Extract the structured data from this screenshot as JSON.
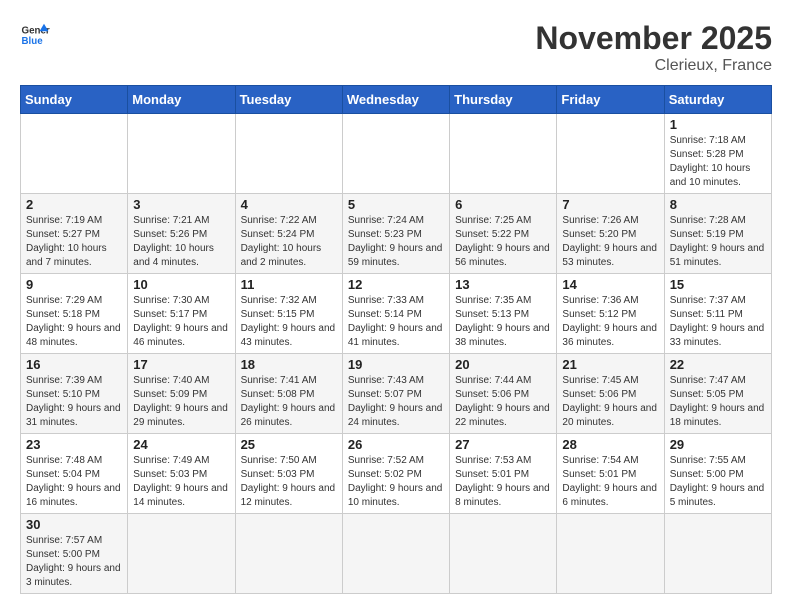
{
  "header": {
    "logo_general": "General",
    "logo_blue": "Blue",
    "month_title": "November 2025",
    "location": "Clerieux, France"
  },
  "days_of_week": [
    "Sunday",
    "Monday",
    "Tuesday",
    "Wednesday",
    "Thursday",
    "Friday",
    "Saturday"
  ],
  "weeks": [
    [
      {
        "day": "",
        "info": ""
      },
      {
        "day": "",
        "info": ""
      },
      {
        "day": "",
        "info": ""
      },
      {
        "day": "",
        "info": ""
      },
      {
        "day": "",
        "info": ""
      },
      {
        "day": "",
        "info": ""
      },
      {
        "day": "1",
        "info": "Sunrise: 7:18 AM\nSunset: 5:28 PM\nDaylight: 10 hours and 10 minutes."
      }
    ],
    [
      {
        "day": "2",
        "info": "Sunrise: 7:19 AM\nSunset: 5:27 PM\nDaylight: 10 hours and 7 minutes."
      },
      {
        "day": "3",
        "info": "Sunrise: 7:21 AM\nSunset: 5:26 PM\nDaylight: 10 hours and 4 minutes."
      },
      {
        "day": "4",
        "info": "Sunrise: 7:22 AM\nSunset: 5:24 PM\nDaylight: 10 hours and 2 minutes."
      },
      {
        "day": "5",
        "info": "Sunrise: 7:24 AM\nSunset: 5:23 PM\nDaylight: 9 hours and 59 minutes."
      },
      {
        "day": "6",
        "info": "Sunrise: 7:25 AM\nSunset: 5:22 PM\nDaylight: 9 hours and 56 minutes."
      },
      {
        "day": "7",
        "info": "Sunrise: 7:26 AM\nSunset: 5:20 PM\nDaylight: 9 hours and 53 minutes."
      },
      {
        "day": "8",
        "info": "Sunrise: 7:28 AM\nSunset: 5:19 PM\nDaylight: 9 hours and 51 minutes."
      }
    ],
    [
      {
        "day": "9",
        "info": "Sunrise: 7:29 AM\nSunset: 5:18 PM\nDaylight: 9 hours and 48 minutes."
      },
      {
        "day": "10",
        "info": "Sunrise: 7:30 AM\nSunset: 5:17 PM\nDaylight: 9 hours and 46 minutes."
      },
      {
        "day": "11",
        "info": "Sunrise: 7:32 AM\nSunset: 5:15 PM\nDaylight: 9 hours and 43 minutes."
      },
      {
        "day": "12",
        "info": "Sunrise: 7:33 AM\nSunset: 5:14 PM\nDaylight: 9 hours and 41 minutes."
      },
      {
        "day": "13",
        "info": "Sunrise: 7:35 AM\nSunset: 5:13 PM\nDaylight: 9 hours and 38 minutes."
      },
      {
        "day": "14",
        "info": "Sunrise: 7:36 AM\nSunset: 5:12 PM\nDaylight: 9 hours and 36 minutes."
      },
      {
        "day": "15",
        "info": "Sunrise: 7:37 AM\nSunset: 5:11 PM\nDaylight: 9 hours and 33 minutes."
      }
    ],
    [
      {
        "day": "16",
        "info": "Sunrise: 7:39 AM\nSunset: 5:10 PM\nDaylight: 9 hours and 31 minutes."
      },
      {
        "day": "17",
        "info": "Sunrise: 7:40 AM\nSunset: 5:09 PM\nDaylight: 9 hours and 29 minutes."
      },
      {
        "day": "18",
        "info": "Sunrise: 7:41 AM\nSunset: 5:08 PM\nDaylight: 9 hours and 26 minutes."
      },
      {
        "day": "19",
        "info": "Sunrise: 7:43 AM\nSunset: 5:07 PM\nDaylight: 9 hours and 24 minutes."
      },
      {
        "day": "20",
        "info": "Sunrise: 7:44 AM\nSunset: 5:06 PM\nDaylight: 9 hours and 22 minutes."
      },
      {
        "day": "21",
        "info": "Sunrise: 7:45 AM\nSunset: 5:06 PM\nDaylight: 9 hours and 20 minutes."
      },
      {
        "day": "22",
        "info": "Sunrise: 7:47 AM\nSunset: 5:05 PM\nDaylight: 9 hours and 18 minutes."
      }
    ],
    [
      {
        "day": "23",
        "info": "Sunrise: 7:48 AM\nSunset: 5:04 PM\nDaylight: 9 hours and 16 minutes."
      },
      {
        "day": "24",
        "info": "Sunrise: 7:49 AM\nSunset: 5:03 PM\nDaylight: 9 hours and 14 minutes."
      },
      {
        "day": "25",
        "info": "Sunrise: 7:50 AM\nSunset: 5:03 PM\nDaylight: 9 hours and 12 minutes."
      },
      {
        "day": "26",
        "info": "Sunrise: 7:52 AM\nSunset: 5:02 PM\nDaylight: 9 hours and 10 minutes."
      },
      {
        "day": "27",
        "info": "Sunrise: 7:53 AM\nSunset: 5:01 PM\nDaylight: 9 hours and 8 minutes."
      },
      {
        "day": "28",
        "info": "Sunrise: 7:54 AM\nSunset: 5:01 PM\nDaylight: 9 hours and 6 minutes."
      },
      {
        "day": "29",
        "info": "Sunrise: 7:55 AM\nSunset: 5:00 PM\nDaylight: 9 hours and 5 minutes."
      }
    ],
    [
      {
        "day": "30",
        "info": "Sunrise: 7:57 AM\nSunset: 5:00 PM\nDaylight: 9 hours and 3 minutes."
      },
      {
        "day": "",
        "info": ""
      },
      {
        "day": "",
        "info": ""
      },
      {
        "day": "",
        "info": ""
      },
      {
        "day": "",
        "info": ""
      },
      {
        "day": "",
        "info": ""
      },
      {
        "day": "",
        "info": ""
      }
    ]
  ]
}
